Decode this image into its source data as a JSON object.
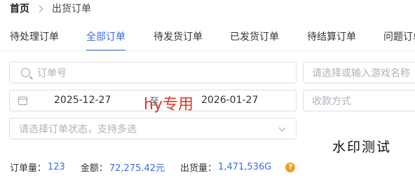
{
  "breadcrumb": {
    "home": "首页",
    "current": "出货订单"
  },
  "tabs": [
    {
      "label": "待处理订单",
      "active": false
    },
    {
      "label": "全部订单",
      "active": true
    },
    {
      "label": "待发货订单",
      "active": false
    },
    {
      "label": "已发货订单",
      "active": false
    },
    {
      "label": "待结算订单",
      "active": false
    },
    {
      "label": "问题订单",
      "active": false
    }
  ],
  "filters": {
    "order_no_placeholder": "订单号",
    "game_placeholder": "请选择或输入游戏名称",
    "date_start": "2025-12-27",
    "date_separator": "至",
    "date_end": "2026-01-27",
    "payment_placeholder": "收款方式",
    "status_placeholder": "请选择订单状态，支持多选"
  },
  "watermarks": {
    "overlay_red": "hy专用",
    "overlay_black": "水印测试"
  },
  "summary": {
    "order_count_label": "订单量：",
    "order_count": "123",
    "amount_label": "金额：",
    "amount": "72,275.42元",
    "shipped_label": "出货量：",
    "shipped": "1,471,536G",
    "help_symbol": "?"
  },
  "colors": {
    "accent": "#3a6bea",
    "watermark_red": "#e0352b",
    "help_badge": "#f0a020"
  },
  "icons": [
    "search-icon",
    "calendar-icon",
    "chevron-down-icon",
    "help-icon"
  ]
}
